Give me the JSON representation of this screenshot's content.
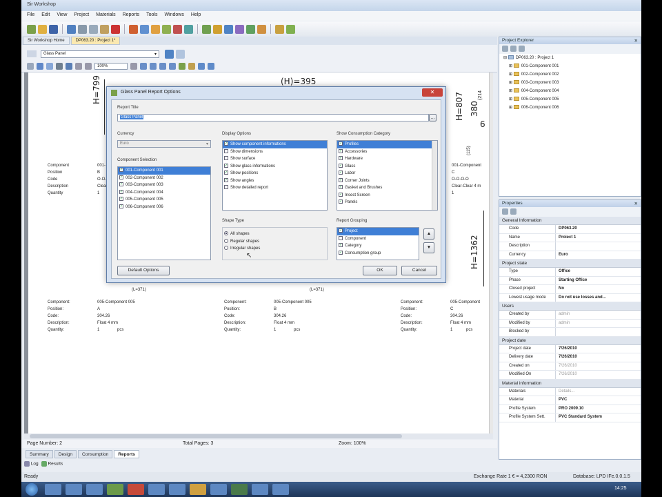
{
  "window": {
    "title": "Sir Workshop"
  },
  "menu": [
    "File",
    "Edit",
    "View",
    "Project",
    "Materials",
    "Reports",
    "Tools",
    "Windows",
    "Help"
  ],
  "doc_tabs": [
    "Sir Workshop Home",
    "DP063.20 : Project 1*"
  ],
  "report_toolbar": {
    "report_select": "Glass Panel",
    "zoom": "100%"
  },
  "dialog": {
    "title": "Glass Panel Report Options",
    "close": "✕",
    "report_title_label": "Report Title",
    "report_title_value": "Glass Panel",
    "currency_label": "Currency",
    "currency_value": "Euro",
    "component_selection_label": "Component Selection",
    "components": [
      "001-Component 001",
      "002-Component 002",
      "003-Component 003",
      "004-Component 004",
      "005-Component 005",
      "006-Component 006"
    ],
    "display_options_label": "Display Options",
    "display_options": [
      {
        "label": "Show component informations",
        "checked": true
      },
      {
        "label": "Show dimensions",
        "checked": false
      },
      {
        "label": "Show surface",
        "checked": false
      },
      {
        "label": "Show glass informations",
        "checked": true
      },
      {
        "label": "Show positions",
        "checked": true
      },
      {
        "label": "Show angles",
        "checked": true
      },
      {
        "label": "Show detailed report",
        "checked": false
      }
    ],
    "consumption_label": "Show Consumption Category",
    "consumption": [
      "Profiles",
      "Accessories",
      "Hardware",
      "Glass",
      "Labor",
      "Corner Joints",
      "Gasket and Brushes",
      "Insect Screen",
      "Panels"
    ],
    "shape_type_label": "Shape Type",
    "shape_types": [
      "All shapes",
      "Regular shapes",
      "Irregular shapes"
    ],
    "report_grouping_label": "Report Grouping",
    "grouping": [
      "Project",
      "Component",
      "Category",
      "Consumption group"
    ],
    "default_button": "Default Options",
    "ok_button": "OK",
    "cancel_button": "Cancel"
  },
  "drawing": {
    "dim_top": "(H)=395",
    "dim_left": "H=799",
    "dim_right_a": "H=807",
    "dim_right_b": "380",
    "dim_right_c": "(214",
    "dim_right_d": "(115)",
    "dim_right_e": "6",
    "dim_right_f": "H=1362",
    "dim_bottom_l": "(L=371)",
    "dim_bottom_m": "(L=371)"
  },
  "info_top_left": {
    "labels": [
      "Component",
      "Position",
      "Code",
      "Description",
      "Quantity"
    ],
    "values": [
      "001-",
      "B",
      "O-O-",
      "Clear",
      "1"
    ]
  },
  "info_top_right": {
    "values": [
      "001-Component",
      "C",
      "O-O-O-O",
      "Clear-Clear 4 m",
      "1"
    ]
  },
  "info_blocks": [
    {
      "labels": [
        "Component:",
        "Position:",
        "Code:",
        "Description:",
        "Quantity:"
      ],
      "values": [
        "005-Component 005",
        "A",
        "304.26",
        "Float 4 mm",
        "1"
      ],
      "unit": "pcs"
    },
    {
      "labels": [
        "Component:",
        "Position:",
        "Code:",
        "Description:",
        "Quantity:"
      ],
      "values": [
        "005-Component 005",
        "B",
        "304.26",
        "Float 4 mm",
        "1"
      ],
      "unit": "pcs"
    },
    {
      "labels": [
        "Component:",
        "Position:",
        "Code:",
        "Description:",
        "Quantity:"
      ],
      "values": [
        "005-Component",
        "C",
        "304.26",
        "Float 4 mm",
        "1"
      ],
      "unit": "pcs"
    }
  ],
  "status": {
    "page": "Page Number: 2",
    "total": "Total Pages: 3",
    "zoom": "Zoom: 100%"
  },
  "bottom_tabs": [
    "Summary",
    "Design",
    "Consumption",
    "Reports"
  ],
  "log_tabs": [
    "Log",
    "Results"
  ],
  "statusbar": {
    "left": "Ready",
    "right1": "Exchange Rate 1 € = 4,2300 RON",
    "right2": "Database: LPD IFe.0.0.1.5"
  },
  "project_explorer": {
    "title": "Project Explorer",
    "root": "DP063.20 : Project 1",
    "items": [
      "001-Component 001",
      "002-Component 002",
      "003-Component 003",
      "004-Component 004",
      "005-Component 005",
      "006-Component 006"
    ]
  },
  "properties": {
    "title": "Properties",
    "sections": [
      {
        "name": "General Information",
        "rows": [
          [
            "Code",
            "DP063.20"
          ],
          [
            "Name",
            "Proiect 1"
          ],
          [
            "Description",
            ""
          ],
          [
            "Currency",
            "Euro"
          ]
        ]
      },
      {
        "name": "Project state",
        "rows": [
          [
            "Type",
            "Office"
          ],
          [
            "Phase",
            "Starting Office"
          ],
          [
            "Closed project",
            "No"
          ],
          [
            "Lowest usage mode",
            "Do not use losses and..."
          ]
        ]
      },
      {
        "name": "Users",
        "rows": [
          [
            "Created by",
            "admin"
          ],
          [
            "Modified by",
            "admin"
          ],
          [
            "Blocked by",
            ""
          ]
        ]
      },
      {
        "name": "Project date",
        "rows": [
          [
            "Project date",
            "7/26/2010"
          ],
          [
            "Delivery date",
            "7/26/2010"
          ],
          [
            "Created on",
            "7/26/2010"
          ],
          [
            "Modified On",
            "7/26/2010"
          ]
        ]
      },
      {
        "name": "Material information",
        "rows": [
          [
            "Materials",
            "Details..."
          ],
          [
            "Material",
            "PVC"
          ],
          [
            "Profile System",
            "PRO 2009.10"
          ],
          [
            "Profile System Sett.",
            "PVC Standard System"
          ]
        ]
      }
    ]
  },
  "taskbar": {
    "time": "14:25"
  }
}
